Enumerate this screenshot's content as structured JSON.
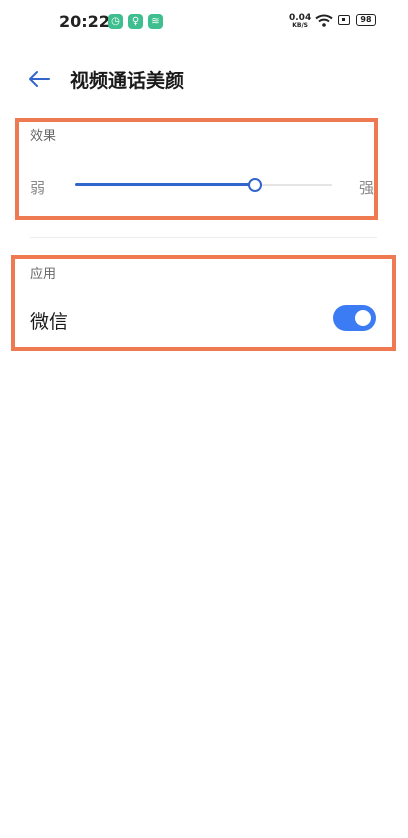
{
  "status_bar": {
    "time": "20:22",
    "net_speed_value": "0.04",
    "net_speed_unit": "KB/S",
    "battery": "98"
  },
  "header": {
    "title": "视频通话美颜"
  },
  "effect_section": {
    "label": "效果",
    "weak_label": "弱",
    "strong_label": "强",
    "level_fraction": 0.7
  },
  "apply_section": {
    "label": "应用",
    "apps": [
      {
        "name": "微信",
        "enabled": true
      }
    ]
  },
  "colors": {
    "accent": "#3366cc",
    "toggle_on": "#3b7cf5",
    "highlight_border": "#ef7a52",
    "notification_icon": "#3fbf8f"
  }
}
